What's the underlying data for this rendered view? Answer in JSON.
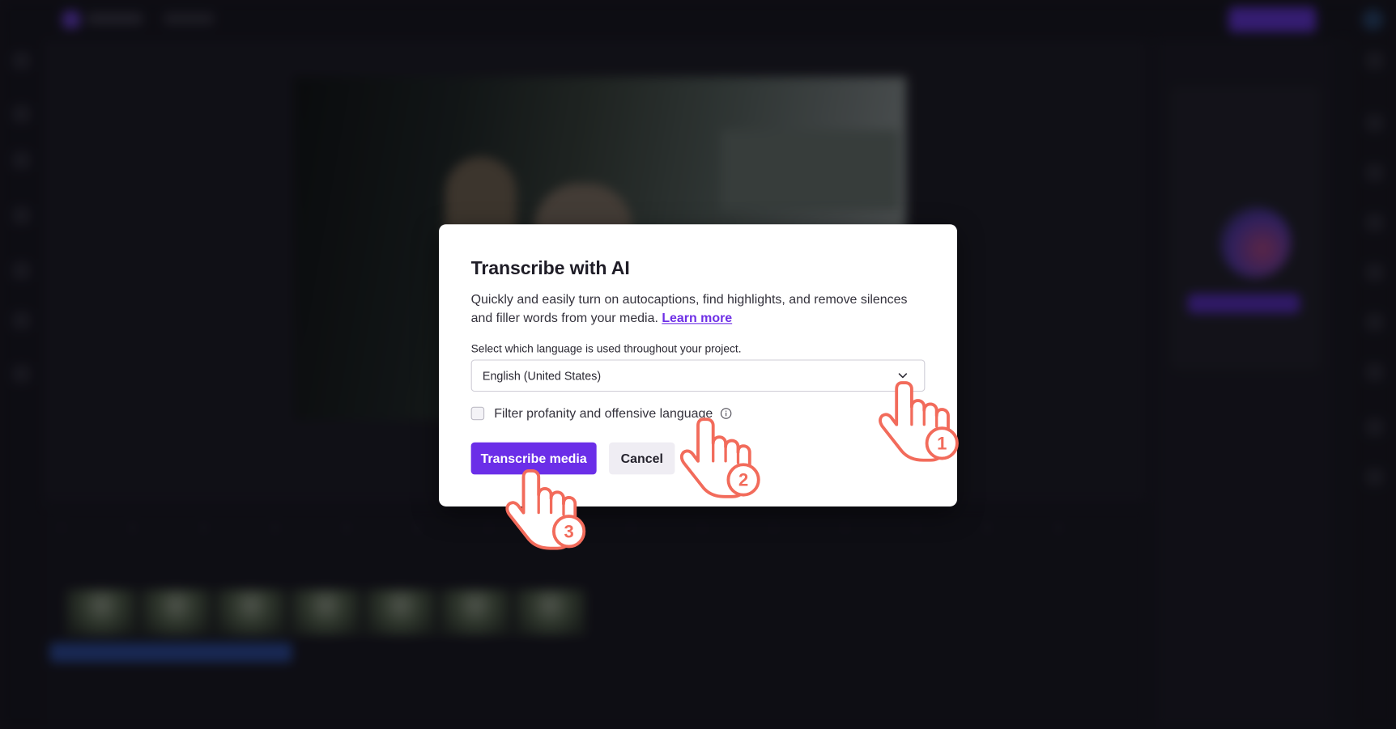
{
  "dialog": {
    "title": "Transcribe with AI",
    "description": "Quickly and easily turn on autocaptions, find highlights, and remove silences and filler words from your media.",
    "learn_more": "Learn more",
    "language_label": "Select which language is used throughout your project.",
    "language_value": "English (United States)",
    "filter_label": "Filter profanity and offensive language",
    "filter_checked": false,
    "primary_button": "Transcribe media",
    "cancel_button": "Cancel"
  },
  "annotations": {
    "steps": [
      "1",
      "2",
      "3"
    ],
    "accent_color": "#f26b5b"
  },
  "colors": {
    "primary": "#6b2ee8",
    "link": "#6e2fe6",
    "backdrop": "#16151c"
  }
}
